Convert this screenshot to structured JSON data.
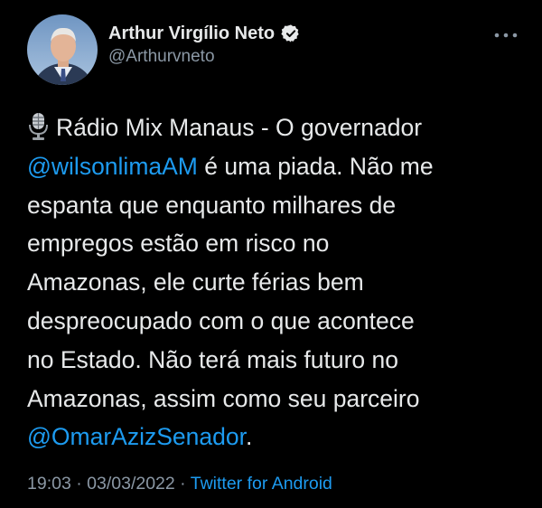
{
  "author": {
    "display_name": "Arthur Virgílio Neto",
    "handle": "@Arthurvneto",
    "verified": true
  },
  "icons": {
    "verified": "verified-badge-icon",
    "more": "more-options-icon",
    "emoji": "studio-microphone-icon"
  },
  "tweet": {
    "line1_text": "Rádio Mix Manaus - O governador",
    "line2_mention": "@wilsonlimaAM",
    "line2_text": " é uma piada. Não me",
    "line3": "espanta que enquanto milhares de",
    "line4": "empregos estão em risco no",
    "line5": "Amazonas, ele curte férias bem",
    "line6": "despreocupado com o que acontece",
    "line7": "no Estado. Não terá mais futuro no",
    "line8": "Amazonas, assim como seu parceiro",
    "line9_mention": "@OmarAzizSenador",
    "line9_text": "."
  },
  "meta": {
    "time": "19:03",
    "separator": " · ",
    "date": "03/03/2022",
    "source": "Twitter for Android"
  },
  "colors": {
    "background": "#000000",
    "text": "#e7e9ea",
    "secondary": "#8b98a5",
    "accent": "#1d9bf0"
  }
}
